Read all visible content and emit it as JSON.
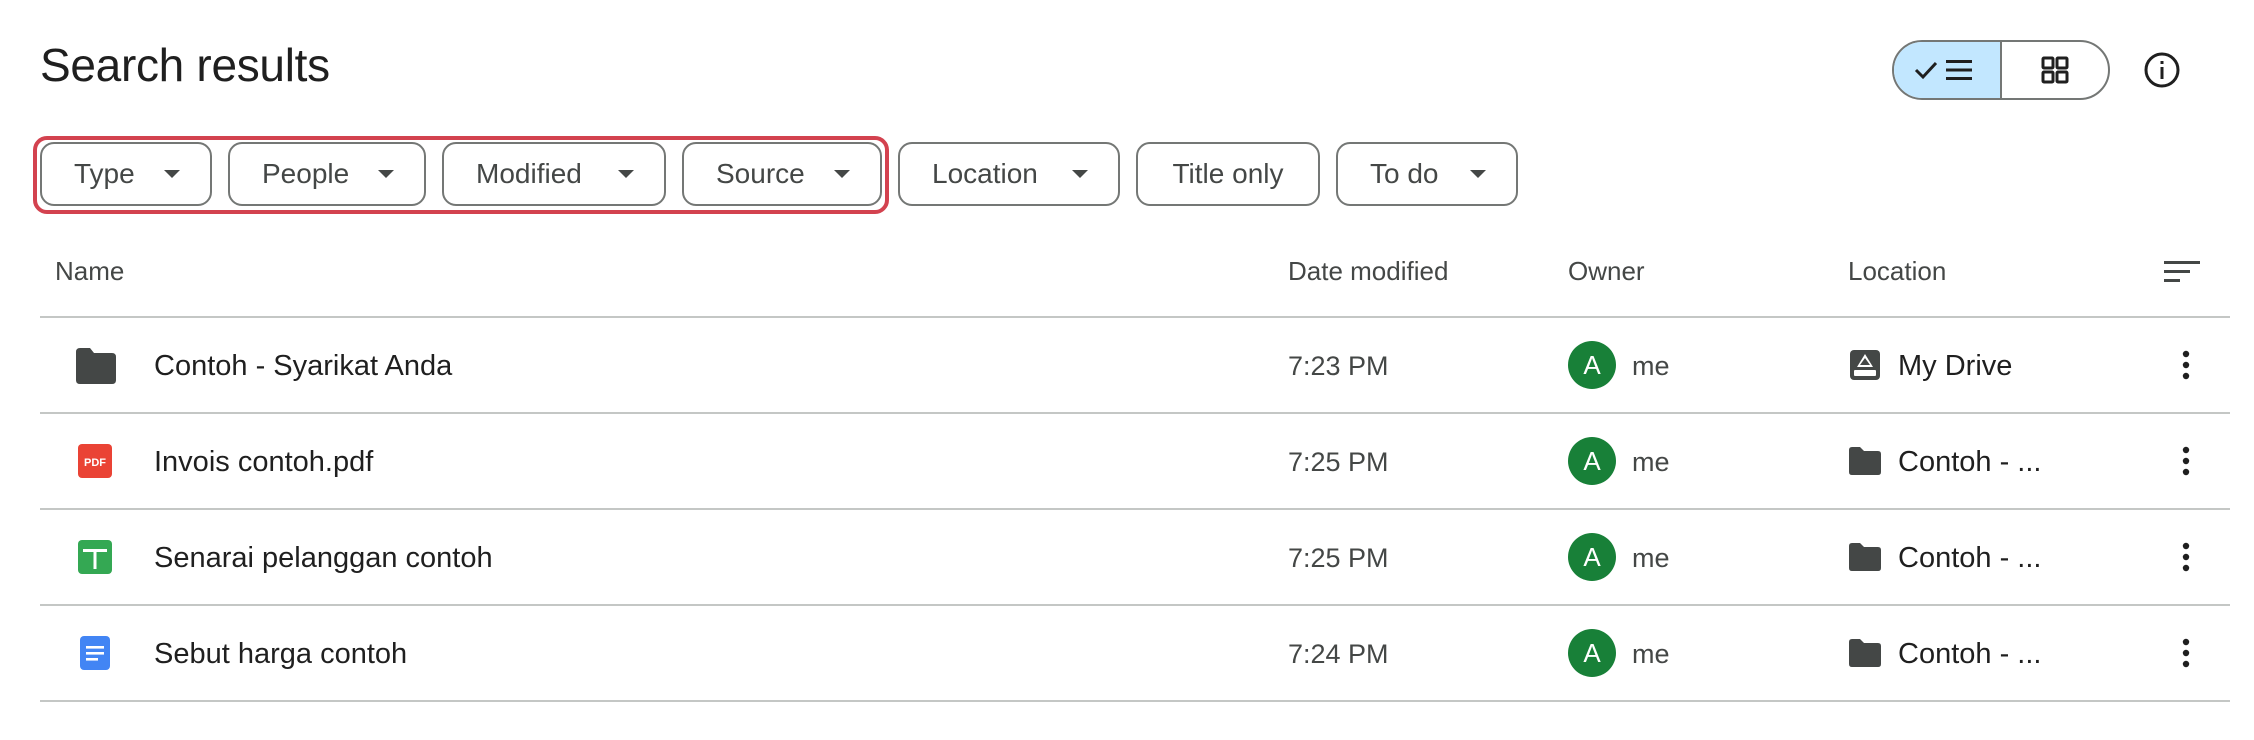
{
  "header": {
    "title": "Search results"
  },
  "filters": [
    {
      "label": "Type",
      "has_dropdown": true
    },
    {
      "label": "People",
      "has_dropdown": true
    },
    {
      "label": "Modified",
      "has_dropdown": true
    },
    {
      "label": "Source",
      "has_dropdown": true
    },
    {
      "label": "Location",
      "has_dropdown": true
    },
    {
      "label": "Title only",
      "has_dropdown": false
    },
    {
      "label": "To do",
      "has_dropdown": true
    }
  ],
  "table": {
    "columns": {
      "name": "Name",
      "date_modified": "Date modified",
      "owner": "Owner",
      "location": "Location"
    },
    "rows": [
      {
        "name": "Contoh - Syarikat Anda",
        "icon": "folder-icon",
        "date": "7:23 PM",
        "avatar": "A",
        "owner": "me",
        "location": "My Drive",
        "location_icon": "my-drive-icon"
      },
      {
        "name": "Invois contoh.pdf",
        "icon": "pdf-icon",
        "date": "7:25 PM",
        "avatar": "A",
        "owner": "me",
        "location": "Contoh - ...",
        "location_icon": "folder-icon"
      },
      {
        "name": "Senarai pelanggan contoh",
        "icon": "sheets-icon",
        "date": "7:25 PM",
        "avatar": "A",
        "owner": "me",
        "location": "Contoh - ...",
        "location_icon": "folder-icon"
      },
      {
        "name": "Sebut harga contoh",
        "icon": "docs-icon",
        "date": "7:24 PM",
        "avatar": "A",
        "owner": "me",
        "location": "Contoh - ...",
        "location_icon": "folder-icon"
      }
    ]
  },
  "icons": {
    "pdf_label": "PDF"
  },
  "colors": {
    "highlight": "#d3424f",
    "selected_toggle": "#c2e7ff",
    "avatar": "#188038",
    "pdf": "#ea4335",
    "sheets": "#34a853",
    "docs": "#4285f4",
    "folder": "#444746"
  }
}
